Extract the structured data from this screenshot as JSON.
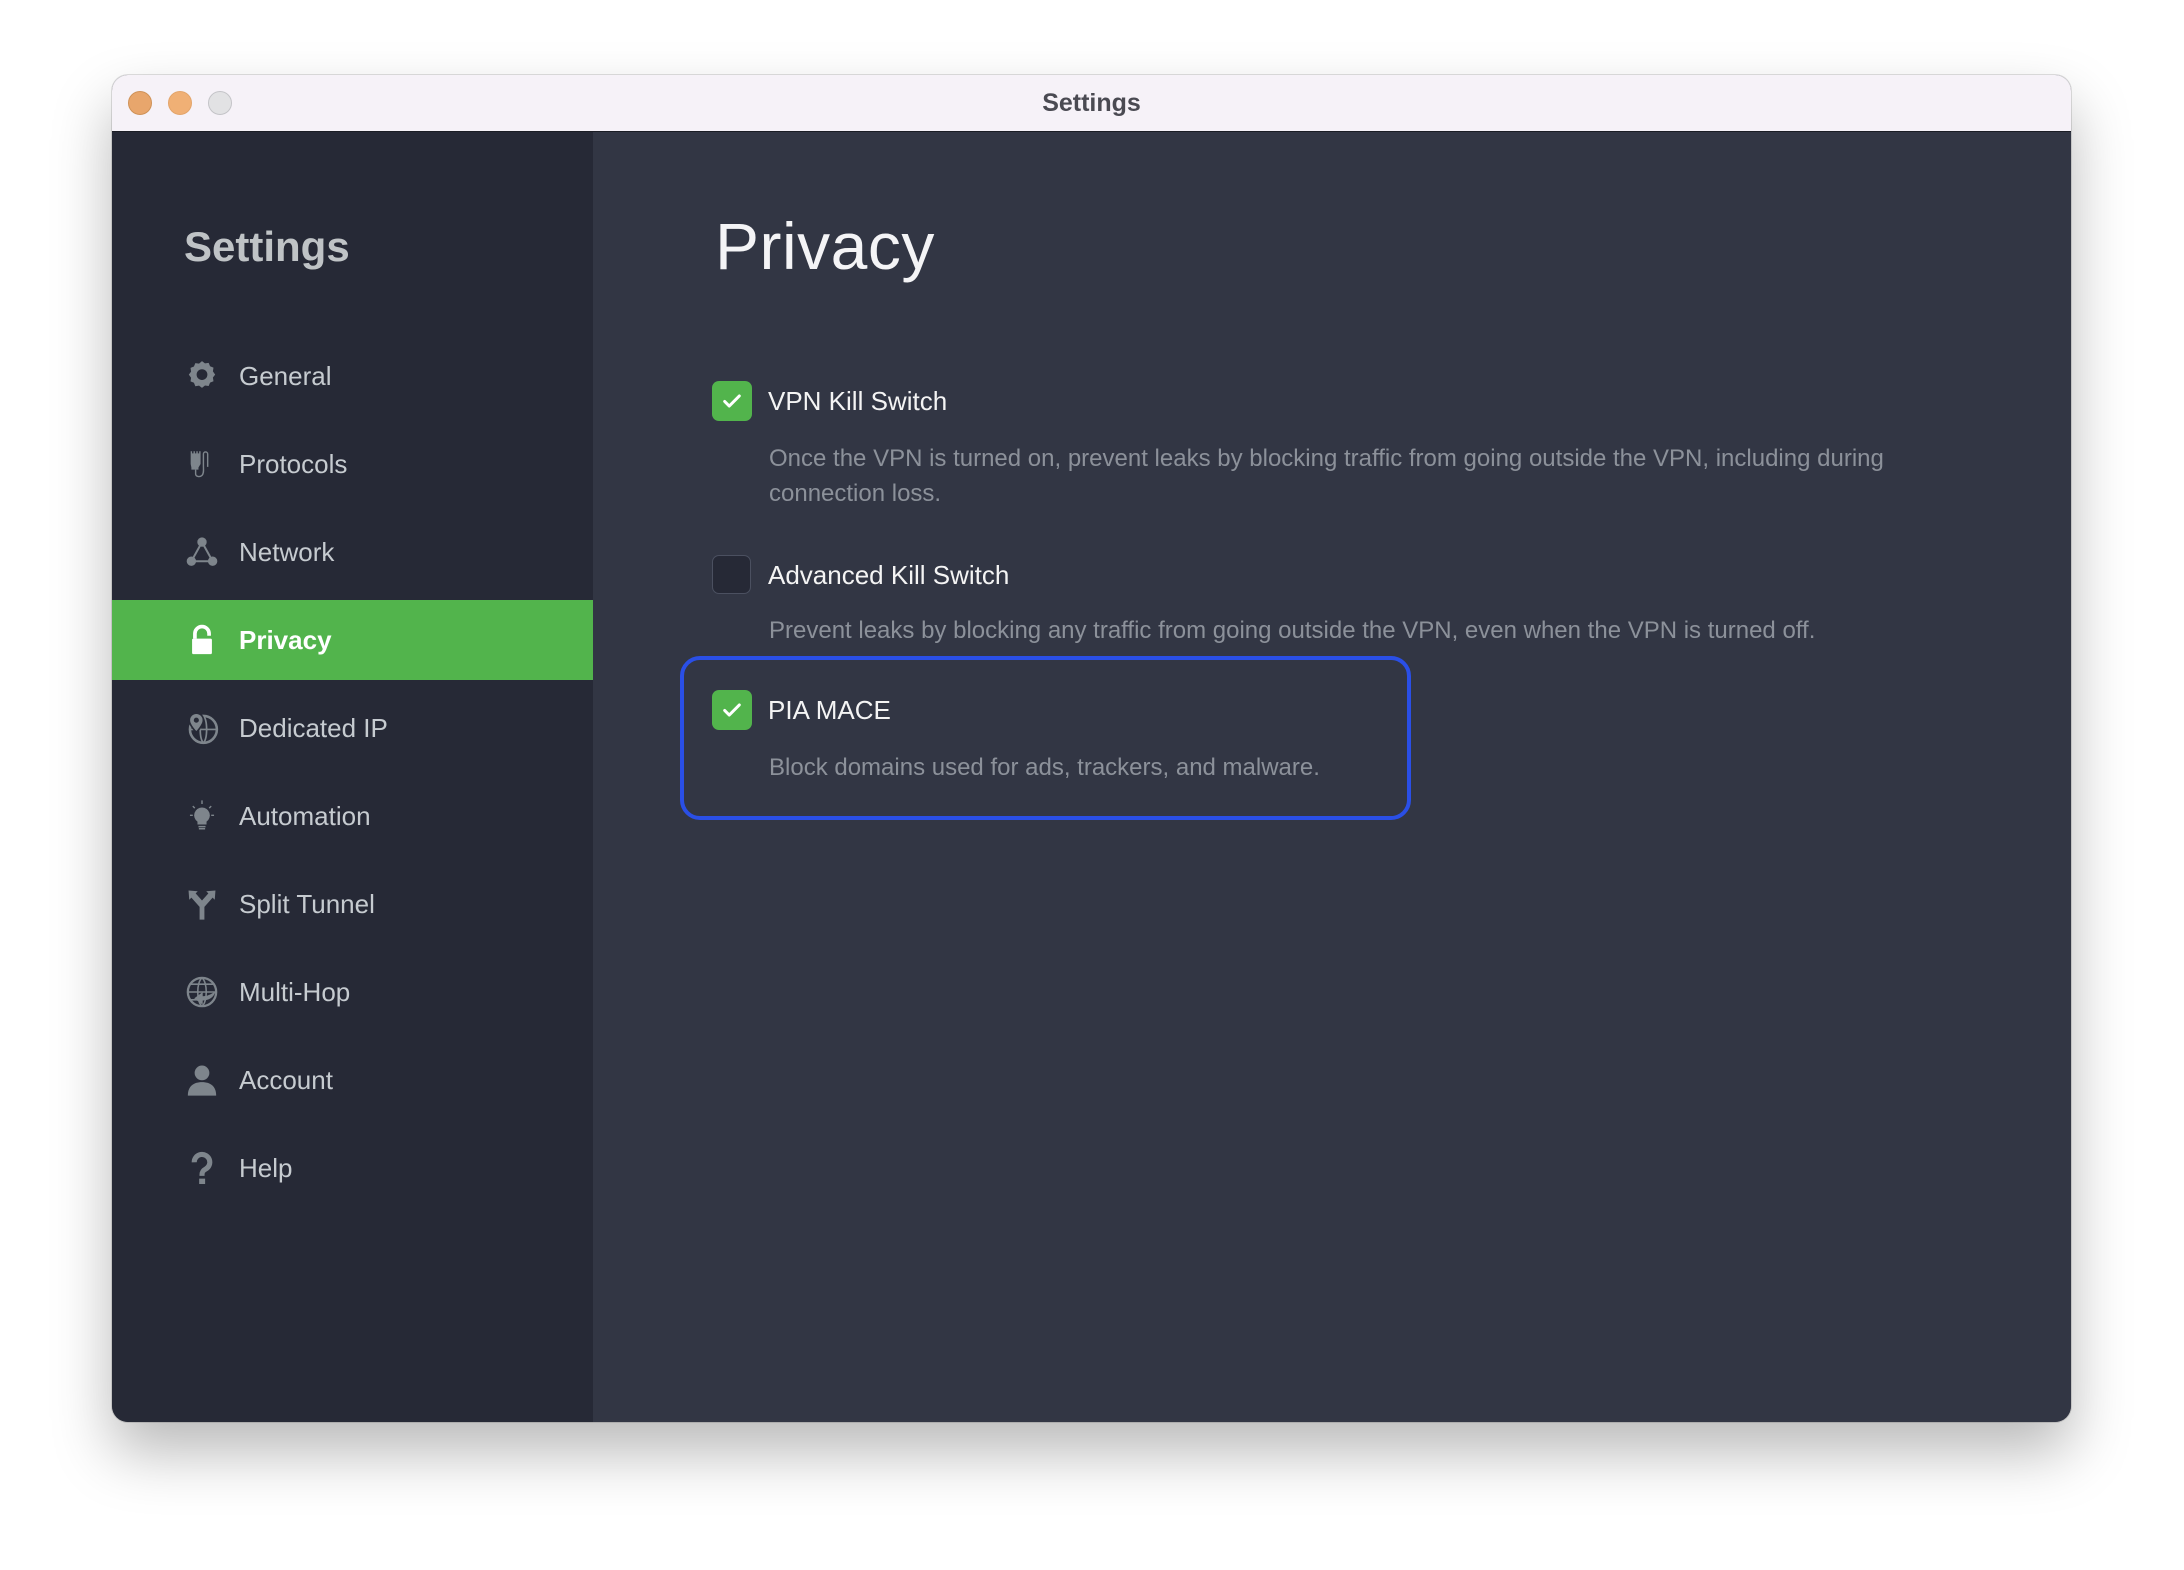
{
  "window": {
    "title": "Settings",
    "controls": [
      "close",
      "minimize",
      "maximize"
    ]
  },
  "sidebar": {
    "title": "Settings",
    "active_item": "Privacy",
    "items": [
      {
        "label": "General",
        "icon": "gear-icon"
      },
      {
        "label": "Protocols",
        "icon": "ethernet-plug-icon"
      },
      {
        "label": "Network",
        "icon": "network-nodes-icon"
      },
      {
        "label": "Privacy",
        "icon": "lock-icon"
      },
      {
        "label": "Dedicated IP",
        "icon": "globe-pin-icon"
      },
      {
        "label": "Automation",
        "icon": "lightbulb-icon"
      },
      {
        "label": "Split Tunnel",
        "icon": "split-arrows-icon"
      },
      {
        "label": "Multi-Hop",
        "icon": "globe-arrow-icon"
      },
      {
        "label": "Account",
        "icon": "user-icon"
      },
      {
        "label": "Help",
        "icon": "question-icon"
      }
    ]
  },
  "main": {
    "title": "Privacy",
    "options": [
      {
        "label": "VPN Kill Switch",
        "checked": true,
        "description": "Once the VPN is turned on, prevent leaks by blocking traffic from going outside the VPN, including during connection loss."
      },
      {
        "label": "Advanced Kill Switch",
        "checked": false,
        "description": "Prevent leaks by blocking any traffic from going outside the VPN, even when the VPN is turned off."
      },
      {
        "label": "PIA MACE",
        "checked": true,
        "highlighted": true,
        "description": "Block domains used for ads, trackers, and malware."
      }
    ]
  },
  "colors": {
    "accent_green": "#52b44c",
    "highlight_blue": "#2a4fe6",
    "sidebar_bg": "#262936",
    "main_bg": "#323644"
  }
}
